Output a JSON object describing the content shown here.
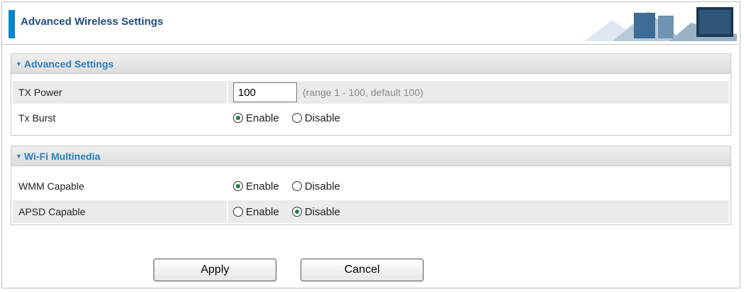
{
  "page": {
    "title": "Advanced Wireless Settings"
  },
  "advanced": {
    "header": "Advanced Settings",
    "tx_power": {
      "label": "TX Power",
      "value": "100",
      "hint": "(range 1 - 100, default 100)"
    },
    "tx_burst": {
      "label": "Tx Burst",
      "enable_label": "Enable",
      "disable_label": "Disable",
      "selected": "Enable"
    }
  },
  "wmm": {
    "header": "Wi-Fi Multinedia",
    "wmm_capable": {
      "label": "WMM Capable",
      "enable_label": "Enable",
      "disable_label": "Disable",
      "selected": "Enable"
    },
    "apsd_capable": {
      "label": "APSD Capable",
      "enable_label": "Enable",
      "disable_label": "Disable",
      "selected": "Disable"
    }
  },
  "buttons": {
    "apply": "Apply",
    "cancel": "Cancel"
  },
  "colors": {
    "accent": "#0a84d0",
    "header_text": "#2a7fc0",
    "title_text": "#1f4f86"
  }
}
